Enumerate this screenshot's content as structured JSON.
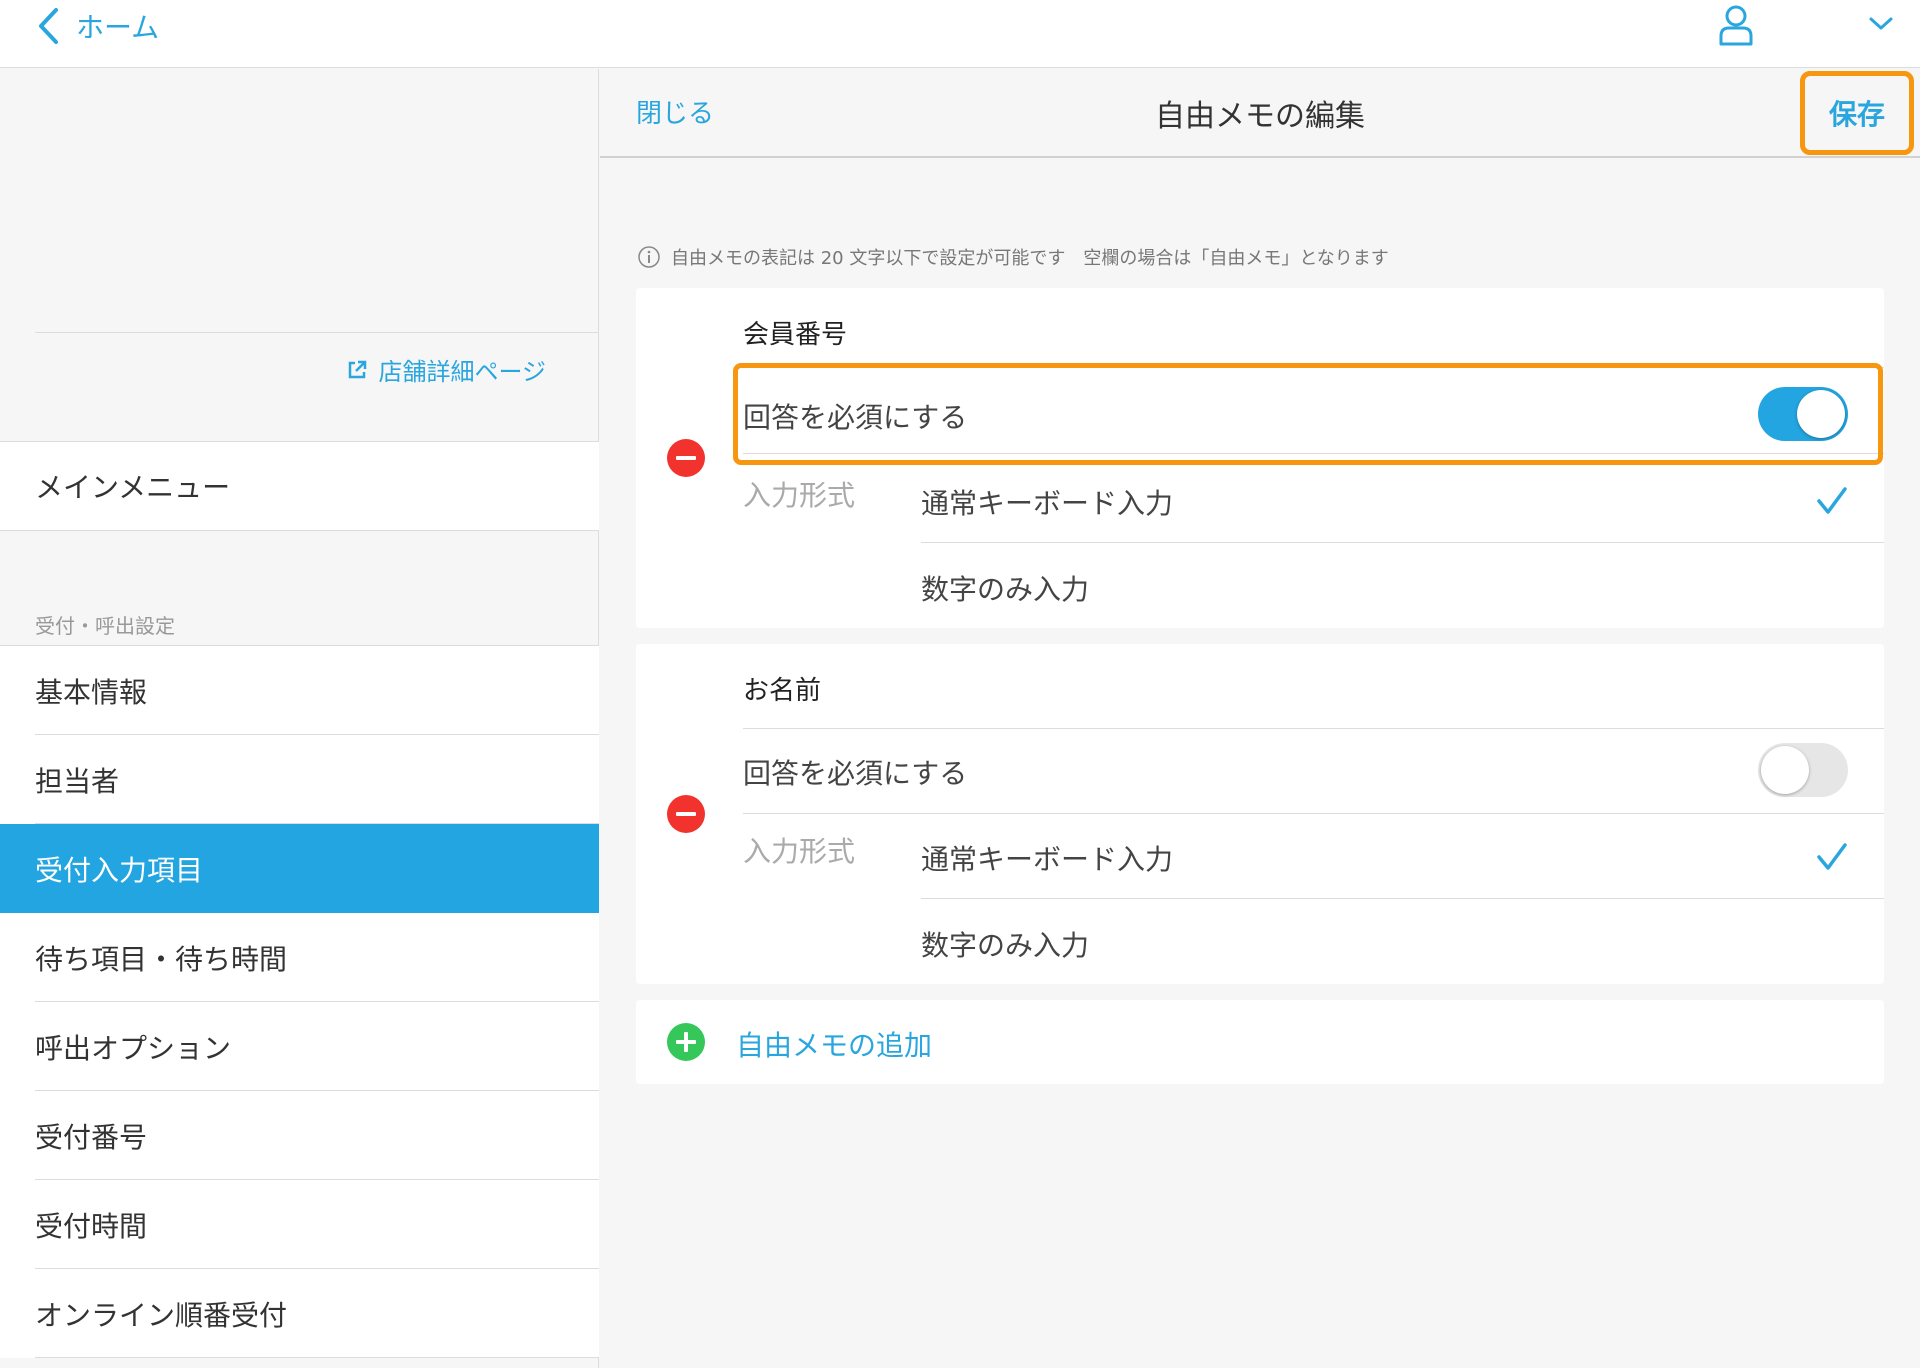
{
  "topbar": {
    "back_label": "ホーム"
  },
  "sidebar": {
    "store_link": "店舗詳細ページ",
    "main_menu": "メインメニュー",
    "section_label": "受付・呼出設定",
    "items": [
      {
        "label": "基本情報",
        "active": false
      },
      {
        "label": "担当者",
        "active": false
      },
      {
        "label": "受付入力項目",
        "active": true
      },
      {
        "label": "待ち項目・待ち時間",
        "active": false
      },
      {
        "label": "呼出オプション",
        "active": false
      },
      {
        "label": "受付番号",
        "active": false
      },
      {
        "label": "受付時間",
        "active": false
      },
      {
        "label": "オンライン順番受付",
        "active": false
      }
    ]
  },
  "panel": {
    "close_label": "閉じる",
    "title": "自由メモの編集",
    "save_label": "保存",
    "notice": "自由メモの表記は 20 文字以下で設定が可能です　空欄の場合は「自由メモ」となります",
    "memos": [
      {
        "name": "会員番号",
        "required_label": "回答を必須にする",
        "required": true,
        "input_type_label": "入力形式",
        "options": [
          "通常キーボード入力",
          "数字のみ入力"
        ],
        "selected_option": "通常キーボード入力"
      },
      {
        "name": "お名前",
        "required_label": "回答を必須にする",
        "required": false,
        "input_type_label": "入力形式",
        "options": [
          "通常キーボード入力",
          "数字のみ入力"
        ],
        "selected_option": "通常キーボード入力"
      }
    ],
    "add_label": "自由メモの追加"
  },
  "colors": {
    "accent": "#22a5e0",
    "highlight": "#f7960f",
    "remove": "#f2332d",
    "add": "#35c759"
  },
  "icons": [
    "back-chevron-icon",
    "user-icon",
    "chevron-down-icon",
    "external-link-icon",
    "info-icon",
    "minus-circle-icon",
    "check-icon",
    "plus-circle-icon"
  ]
}
